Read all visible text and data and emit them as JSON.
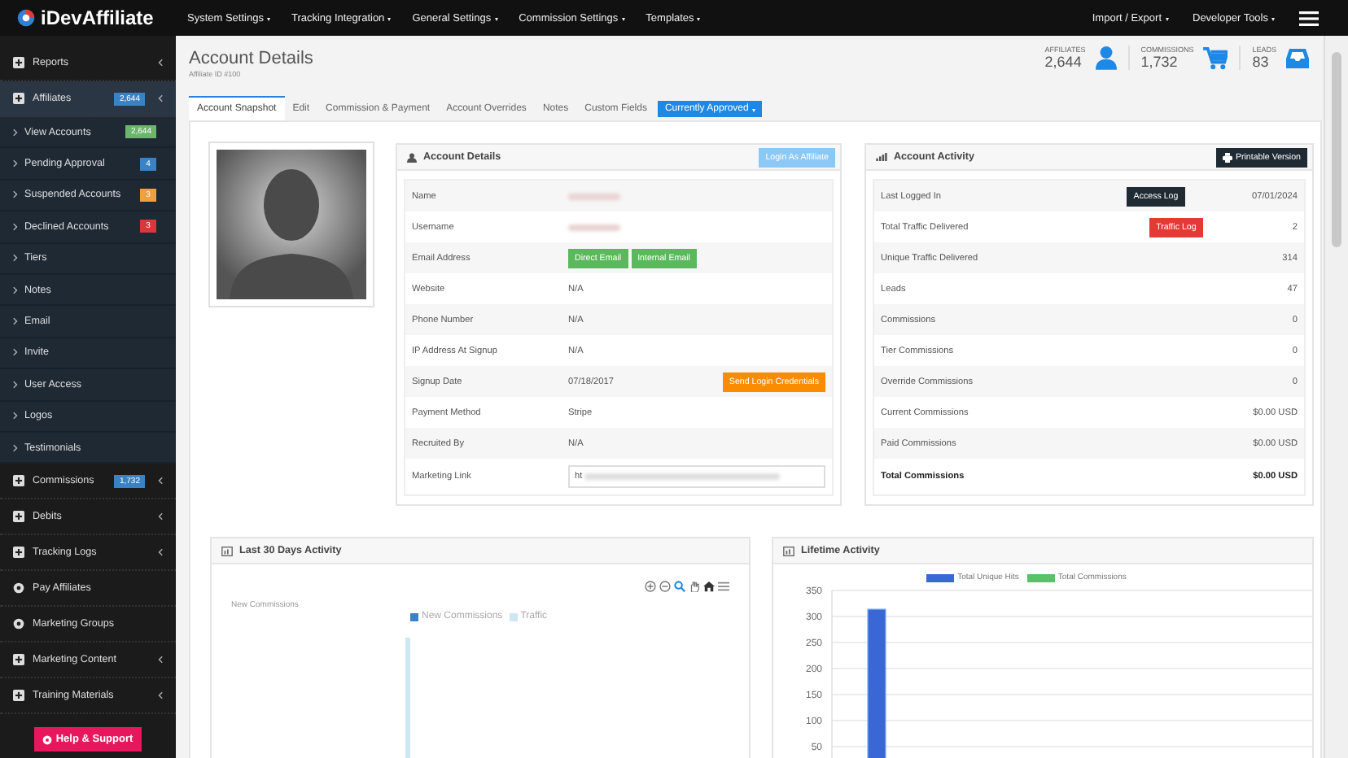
{
  "topbar": {
    "logo": "iDevAffiliate",
    "menus": [
      {
        "label": "System Settings"
      },
      {
        "label": "Tracking Integration"
      },
      {
        "label": "General Settings"
      },
      {
        "label": "Commission Settings"
      },
      {
        "label": "Templates"
      }
    ],
    "right_menus": [
      {
        "label": "Import / Export"
      },
      {
        "label": "Developer Tools"
      }
    ]
  },
  "sidebar": {
    "items": [
      {
        "label": "Reports",
        "kind": "group",
        "expanded": false
      },
      {
        "label": "Affiliates",
        "kind": "group",
        "expanded": true,
        "badge": {
          "text": "2,644",
          "color": "#3b82c4"
        },
        "children": [
          {
            "label": "View Accounts",
            "badge": {
              "text": "2,644",
              "color": "#6cb56c"
            }
          },
          {
            "label": "Pending Approval",
            "badge": {
              "text": "4",
              "color": "#3b82c4"
            }
          },
          {
            "label": "Suspended Accounts",
            "badge": {
              "text": "3",
              "color": "#f0a040"
            }
          },
          {
            "label": "Declined Accounts",
            "badge": {
              "text": "3",
              "color": "#d9363e"
            }
          },
          {
            "label": "Tiers"
          },
          {
            "label": "Notes"
          },
          {
            "label": "Email"
          },
          {
            "label": "Invite"
          },
          {
            "label": "User Access"
          },
          {
            "label": "Logos"
          },
          {
            "label": "Testimonials"
          }
        ]
      },
      {
        "label": "Commissions",
        "kind": "group",
        "expanded": false,
        "badge": {
          "text": "1,732",
          "color": "#3b82c4"
        }
      },
      {
        "label": "Debits",
        "kind": "group",
        "expanded": false
      },
      {
        "label": "Tracking Logs",
        "kind": "group",
        "expanded": false
      },
      {
        "label": "Pay Affiliates",
        "kind": "link"
      },
      {
        "label": "Marketing Groups",
        "kind": "link"
      },
      {
        "label": "Marketing Content",
        "kind": "group",
        "expanded": false
      },
      {
        "label": "Training Materials",
        "kind": "group",
        "expanded": false
      }
    ],
    "help_button": "Help & Support"
  },
  "header": {
    "title": "Account Details",
    "subtitle": "Affiliate ID #100",
    "stats": [
      {
        "label": "AFFILIATES",
        "value": "2,644",
        "kind": "user"
      },
      {
        "label": "COMMISSIONS",
        "value": "1,732",
        "kind": "cart"
      },
      {
        "label": "LEADS",
        "value": "83",
        "kind": "inbox"
      }
    ]
  },
  "tabs": [
    {
      "label": "Account Snapshot",
      "selected": true
    },
    {
      "label": "Edit",
      "selected": false
    },
    {
      "label": "Commission & Payment",
      "selected": false
    },
    {
      "label": "Account Overrides",
      "selected": false
    },
    {
      "label": "Notes",
      "selected": false
    },
    {
      "label": "Custom Fields",
      "selected": false
    }
  ],
  "status_button": "Currently Approved",
  "account_details": {
    "title": "Account Details",
    "action": "Login As Affiliate",
    "rows": [
      {
        "label": "Name",
        "kind": "redacted"
      },
      {
        "label": "Username",
        "kind": "redacted"
      },
      {
        "label": "Email Address",
        "kind": "buttons",
        "buttons": [
          {
            "label": "Direct Email",
            "color": "#5cb85c"
          },
          {
            "label": "Internal Email",
            "color": "#5cb85c"
          }
        ]
      },
      {
        "label": "Website",
        "kind": "text",
        "value": "N/A"
      },
      {
        "label": "Phone Number",
        "kind": "text",
        "value": "N/A"
      },
      {
        "label": "IP Address At Signup",
        "kind": "text",
        "value": "N/A"
      },
      {
        "label": "Signup Date",
        "kind": "text",
        "value": "07/18/2017",
        "buttons": [
          {
            "label": "Send Login Credentials",
            "color": "#fb8c00"
          }
        ]
      },
      {
        "label": "Payment Method",
        "kind": "text",
        "value": "Stripe"
      },
      {
        "label": "Recruited By",
        "kind": "text",
        "value": "N/A"
      },
      {
        "label": "Marketing Link",
        "kind": "field",
        "value": "ht"
      }
    ]
  },
  "account_activity": {
    "title": "Account Activity",
    "action": "Printable Version",
    "rows": [
      {
        "label": "Last Logged In",
        "value": "07/01/2024",
        "button": {
          "label": "Access Log",
          "color": "#1f2a33"
        }
      },
      {
        "label": "Total Traffic Delivered",
        "value": "2",
        "button": {
          "label": "Traffic Log",
          "color": "#e53935"
        }
      },
      {
        "label": "Unique Traffic Delivered",
        "value": "314"
      },
      {
        "label": "Leads",
        "value": "47"
      },
      {
        "label": "Commissions",
        "value": "0"
      },
      {
        "label": "Tier Commissions",
        "value": "0"
      },
      {
        "label": "Override Commissions",
        "value": "0"
      },
      {
        "label": "Current Commissions",
        "value": "$0.00 USD"
      },
      {
        "label": "Paid Commissions",
        "value": "$0.00 USD"
      },
      {
        "label": "Total Commissions",
        "value": "$0.00 USD",
        "kind": "total"
      }
    ]
  },
  "last_30_days": {
    "title": "Last 30 Days Activity",
    "ylabel": "New Commissions",
    "legend": [
      {
        "label": "New Commissions",
        "color": "#3b82c4"
      },
      {
        "label": "Traffic",
        "color": "#cfe6f5"
      }
    ]
  },
  "lifetime": {
    "title": "Lifetime Activity",
    "chart_data": {
      "type": "bar",
      "grid": true,
      "ylim": [
        0,
        350
      ],
      "yticks": [
        50,
        100,
        150,
        200,
        250,
        300,
        350
      ],
      "series": [
        {
          "name": "Total Unique Hits",
          "color": "#3a67d6",
          "values": [
            314
          ]
        },
        {
          "name": "Total Commissions",
          "color": "#5cbf6a",
          "values": [
            0
          ]
        }
      ]
    }
  }
}
